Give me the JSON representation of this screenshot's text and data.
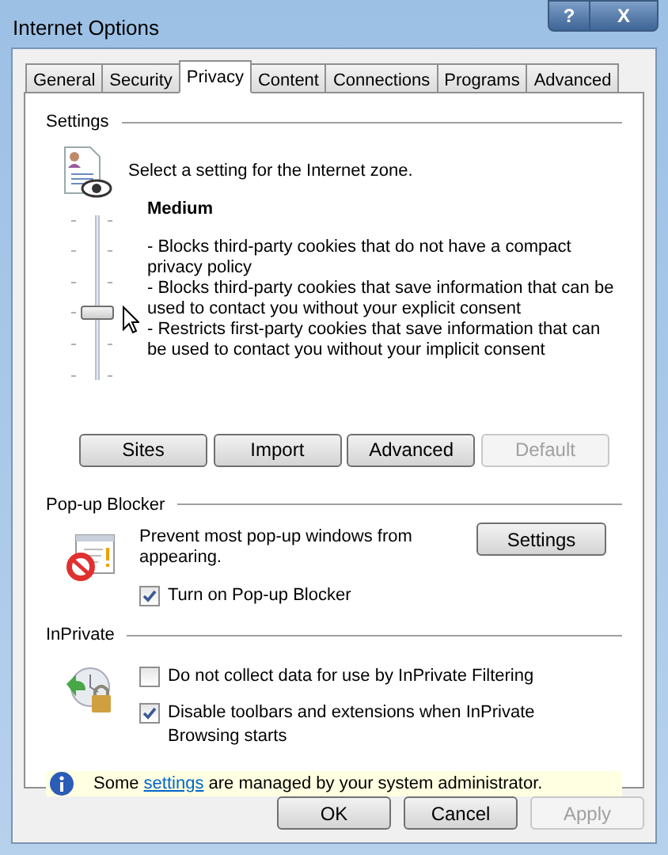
{
  "window": {
    "title": "Internet Options",
    "help": "?",
    "close": "X"
  },
  "tabs": [
    {
      "label": "General",
      "selected": false
    },
    {
      "label": "Security",
      "selected": false
    },
    {
      "label": "Privacy",
      "selected": true
    },
    {
      "label": "Content",
      "selected": false
    },
    {
      "label": "Connections",
      "selected": false
    },
    {
      "label": "Programs",
      "selected": false
    },
    {
      "label": "Advanced",
      "selected": false
    }
  ],
  "settings": {
    "heading": "Settings",
    "intro": "Select a setting for the Internet zone.",
    "slider": {
      "level": 0.4
    },
    "level_name": "Medium",
    "description": [
      "- Blocks third-party cookies that do not have a compact privacy policy",
      "- Blocks third-party cookies that save information that can be used to contact you without your explicit consent",
      "- Restricts first-party cookies that save information that can be used to contact you without your implicit consent"
    ],
    "buttons": [
      {
        "label": "Sites",
        "disabled": false
      },
      {
        "label": "Import",
        "disabled": false
      },
      {
        "label": "Advanced",
        "disabled": false
      },
      {
        "label": "Default",
        "disabled": true
      }
    ]
  },
  "popup_blocker": {
    "heading": "Pop-up Blocker",
    "text": "Prevent most pop-up windows from appearing.",
    "button": "Settings",
    "checkbox": {
      "label": "Turn on Pop-up Blocker",
      "checked": true
    }
  },
  "inprivate": {
    "heading": "InPrivate",
    "checkboxes": [
      {
        "label": "Do not collect data for use by InPrivate Filtering",
        "checked": false
      },
      {
        "label": "Disable toolbars and extensions when InPrivate Browsing starts",
        "checked": true
      }
    ]
  },
  "info": {
    "before": "Some ",
    "link": "settings",
    "after": " are managed by your system administrator."
  },
  "footer_buttons": [
    {
      "label": "OK",
      "disabled": false
    },
    {
      "label": "Cancel",
      "disabled": false
    },
    {
      "label": "Apply",
      "disabled": true
    }
  ]
}
